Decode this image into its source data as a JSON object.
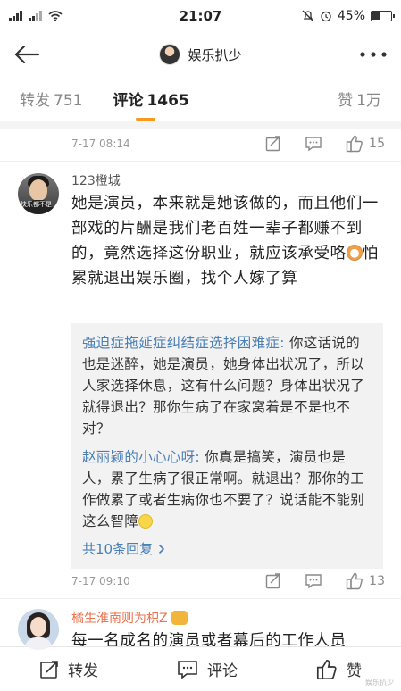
{
  "status_bar": {
    "time": "21:07",
    "battery_text": "45%",
    "battery_level": 0.45
  },
  "navbar": {
    "title": "娱乐扒少"
  },
  "tabs": [
    {
      "label": "转发",
      "count": "751"
    },
    {
      "label": "评论",
      "count": "1465"
    },
    {
      "label": "赞",
      "count": "1万"
    }
  ],
  "first_meta": {
    "time": "7-17 08:14",
    "like_count": "15"
  },
  "comment1": {
    "username": "123橙城",
    "avatar_caption": "快乐都不是",
    "text_part1": "她是演员，本来就是她该做的，而且他们一部戏的片酬是我们老百姓一辈子都赚不到的，竟然选择这份职业，就应该承受咯",
    "text_part2": "怕累就退出娱乐圈，找个人嫁了算",
    "replies": [
      {
        "name": "强迫症拖延症纠结症选择困难症:",
        "text": " 你这话说的也是迷醉，她是演员，她身体出状况了，所以人家选择休息，这有什么问题？身体出状况了就得退出？那你生病了在家窝着是不是也不对？"
      },
      {
        "name": "赵丽颖的小心心呀:",
        "text": " 你真是搞笑，演员也是人，累了生病了很正常啊。就退出？那你的工作做累了或者生病你也不要了？说话能不能别这么智障"
      }
    ],
    "more_replies": "共10条回复",
    "time": "7-17 09:10",
    "like_count": "13"
  },
  "comment2": {
    "username": "橘生淮南则为枳Z",
    "text": "每一名成名的演员或者幕后的工作人员"
  },
  "bottom_bar": {
    "forward": "转发",
    "comment": "评论",
    "like": "赞"
  },
  "watermark": "娱乐扒少"
}
